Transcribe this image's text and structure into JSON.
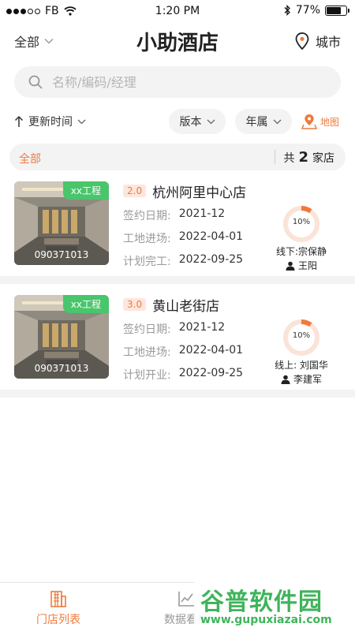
{
  "status_bar": {
    "carrier": "FB",
    "time": "1:20 PM",
    "battery": "77%",
    "battery_level": 0.77
  },
  "header": {
    "filter_all": "全部",
    "title": "小助酒店",
    "city": "城市"
  },
  "search": {
    "placeholder": "名称/编码/经理"
  },
  "filters": {
    "sort_label": "更新时间",
    "version_label": "版本",
    "year_label": "年属",
    "map_label": "地图"
  },
  "summary": {
    "all_label": "全部",
    "prefix": "共",
    "count": "2",
    "suffix": "家店"
  },
  "stores": [
    {
      "tag": "xx工程",
      "code": "090371013",
      "version": "2.0",
      "name": "杭州阿里中心店",
      "line1_label": "签约日期:",
      "line1_value": "2021-12",
      "line2_label": "工地进场:",
      "line2_value": "2022-04-01",
      "line3_label": "计划完工:",
      "line3_value": "2022-09-25",
      "progress_text": "10%",
      "progress": 0.1,
      "manager": "线下:宗保静",
      "person": "王阳"
    },
    {
      "tag": "xx工程",
      "code": "090371013",
      "version": "3.0",
      "name": "黄山老街店",
      "line1_label": "签约日期:",
      "line1_value": "2021-12",
      "line2_label": "工地进场:",
      "line2_value": "2022-04-01",
      "line3_label": "计划开业:",
      "line3_value": "2022-09-25",
      "progress_text": "10%",
      "progress": 0.1,
      "manager": "线上:  刘国华",
      "person": "李建军"
    }
  ],
  "tabs": {
    "stores": "门店列表",
    "data": "数据看板"
  },
  "watermark": {
    "main": "谷普软件园",
    "url": "www.gupuxiazai.com"
  },
  "colors": {
    "accent": "#f07a3c",
    "tag_green": "#49c56b",
    "chip_bg": "#f3f3f3"
  }
}
